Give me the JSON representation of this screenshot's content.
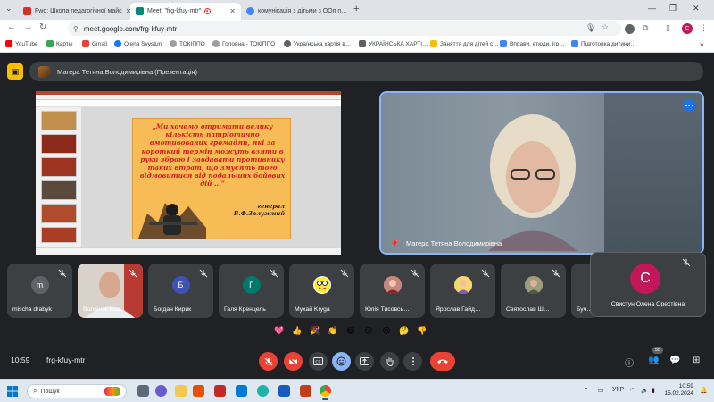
{
  "browser": {
    "tabs": [
      {
        "title": "Fwd: Школа педагогічної майс",
        "active": false,
        "favicon_color": "#d93025"
      },
      {
        "title": "Meet: \"frg-kfuy-mtr\"",
        "active": true,
        "favicon_color": "#00897b"
      },
      {
        "title": "комунікація з дітьми з ООп п…",
        "active": false,
        "favicon_color": "#4285f4"
      }
    ],
    "url": "meet.google.com/frg-kfuy-mtr",
    "bookmarks": [
      {
        "label": "YouTube",
        "color": "#ff0000"
      },
      {
        "label": "Карты",
        "color": "#34a853"
      },
      {
        "label": "Gmail",
        "color": "#ea4335"
      },
      {
        "label": "Olena Svystun",
        "color": "#1877f2"
      },
      {
        "label": "ТОКІППО",
        "color": "#9e9e9e"
      },
      {
        "label": "Головна - ТОКІППО",
        "color": "#9e9e9e"
      },
      {
        "label": "Українська хартія в…",
        "color": "#616161"
      },
      {
        "label": "УКРАЇНСЬКА ХАРТІ…",
        "color": "#616161"
      },
      {
        "label": "Заняття для дітей с…",
        "color": "#fbbc04"
      },
      {
        "label": "Вправи, етюди, ігр…",
        "color": "#4285f4"
      },
      {
        "label": "Підготовка дитини…",
        "color": "#4285f4"
      }
    ]
  },
  "meet": {
    "presenter_banner": "Магера Тетяна Володимирівна (Презентація)",
    "main_tile_name": "Магера Тетяна Володимирівна",
    "slide": {
      "quote": "„Ми хочемо отримати велику кількість патріотично вмотивованих громадян, які за короткий термін можуть взяти в руки зброю і завдавати противнику таких втрат, що змусять того відмовитися від подальших бойових дій ...”",
      "author_role": "генерал",
      "author_name": "В.Ф.Залужний"
    },
    "participants": [
      {
        "name": "mischa drabyk",
        "initial": "m",
        "avatar_color": "#5f6368"
      },
      {
        "name": "Волянюк Бор…",
        "initial": "",
        "avatar_color": "#b9b1a8",
        "video": true
      },
      {
        "name": "Богдан Кирик",
        "initial": "Б",
        "avatar_color": "#3f51b5"
      },
      {
        "name": "Галя Кренцель",
        "initial": "Г",
        "avatar_color": "#00796b"
      },
      {
        "name": "Мухай Kryga",
        "initial": "",
        "avatar_color": "#ffffff"
      },
      {
        "name": "Юлія Тисовсь…",
        "initial": "",
        "avatar_color": "#e8a0a0"
      },
      {
        "name": "Ярослав Гайд…",
        "initial": "",
        "avatar_color": "#fdd663"
      },
      {
        "name": "Святослав Ш…",
        "initial": "",
        "avatar_color": "#a1887f"
      },
      {
        "name": "Буч…",
        "initial": "",
        "avatar_color": "#3c4043"
      }
    ],
    "floating_tile": {
      "name": "Свистун Олена Орестівна",
      "initial": "С"
    },
    "reactions": [
      "💖",
      "👍",
      "🎉",
      "👏",
      "😂",
      "😮",
      "😢",
      "🤔",
      "👎"
    ],
    "clock": "10:59",
    "meeting_code": "frg-kfuy-mtr",
    "participant_count": "55"
  },
  "taskbar": {
    "search_placeholder": "Пошук",
    "lang": "УКР",
    "time": "10:59",
    "date": "15.02.2024"
  }
}
